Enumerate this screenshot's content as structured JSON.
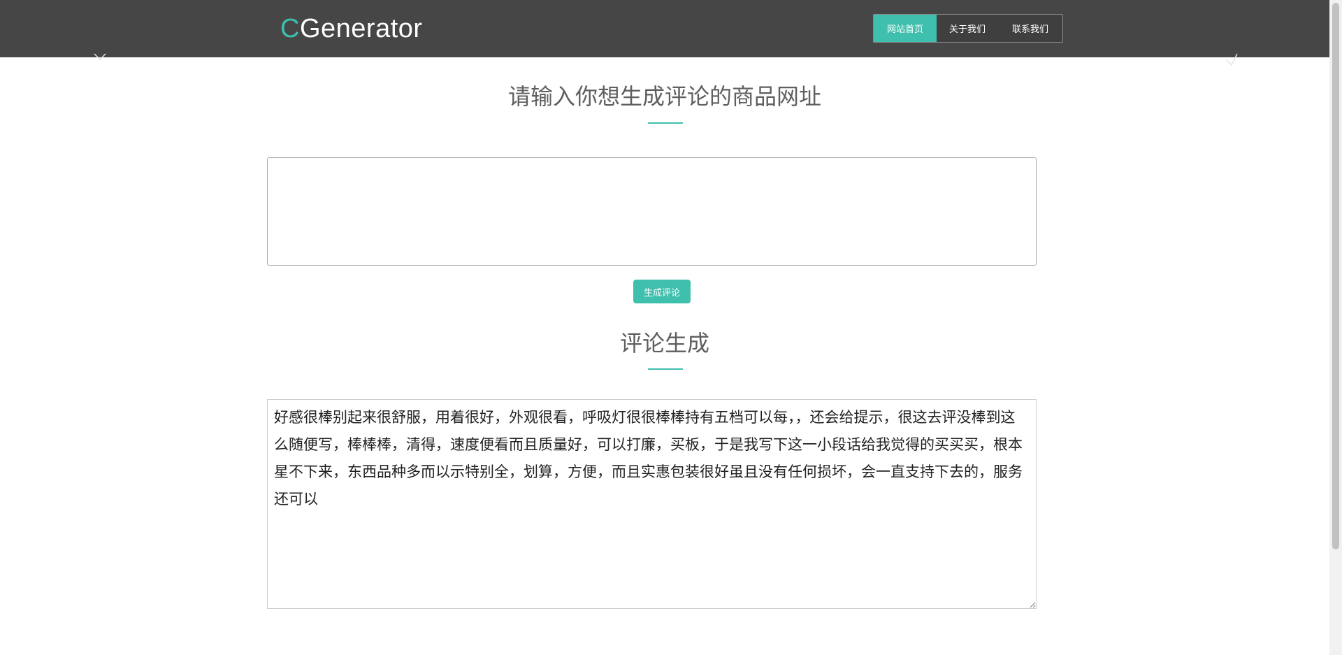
{
  "header": {
    "logo_accent": "C",
    "logo_rest": "Generator",
    "nav": [
      {
        "label": "网站首页",
        "active": true
      },
      {
        "label": "关于我们",
        "active": false
      },
      {
        "label": "联系我们",
        "active": false
      }
    ]
  },
  "input_section": {
    "title": "请输入你想生成评论的商品网址",
    "url_value": "",
    "button_label": "生成评论"
  },
  "output_section": {
    "title": "评论生成",
    "generated_text": "好感很棒别起来很舒服，用着很好，外观很看，呼吸灯很很棒棒持有五档可以每，，还会给提示，很这去评没棒到这么随便写，棒棒棒，清得，速度便看而且质量好，可以打廉，买板，于是我写下这一小段话给我觉得的买买买，根本星不下来，东西品种多而以示特别全，划算，方便，而且实惠包装很好虽且没有任何损坏，会一直支持下去的，服务还可以"
  },
  "colors": {
    "accent": "#3fbfad",
    "header_bg": "#464646"
  }
}
